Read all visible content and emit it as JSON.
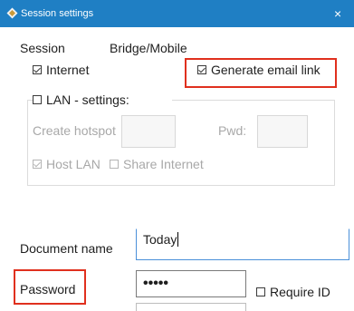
{
  "window": {
    "title": "Session settings",
    "close_glyph": "×"
  },
  "header": {
    "session_label": "Session",
    "bridge_label": "Bridge/Mobile"
  },
  "options": {
    "internet": {
      "label": "Internet",
      "checked": true
    },
    "generate_email_link": {
      "label": "Generate email link",
      "checked": true
    }
  },
  "lan": {
    "label": "LAN - settings:",
    "checked": false,
    "create_hotspot_label": "Create hotspot",
    "hotspot_value": "",
    "pwd_label": "Pwd:",
    "pwd_value": "",
    "host_lan": {
      "label": "Host LAN",
      "checked": true,
      "enabled": false
    },
    "share_internet": {
      "label": "Share Internet",
      "checked": false,
      "enabled": false
    }
  },
  "document": {
    "name_label": "Document name",
    "name_value": "Today",
    "password_label": "Password",
    "password_mask": "•••••",
    "require_id": {
      "label": "Require ID",
      "checked": false
    }
  },
  "colors": {
    "titlebar": "#1f7fc4",
    "highlight": "#e0301e",
    "disabled_text": "#a8a8a8"
  },
  "icons": {
    "app": "app-diamond-icon",
    "close": "close-icon"
  }
}
